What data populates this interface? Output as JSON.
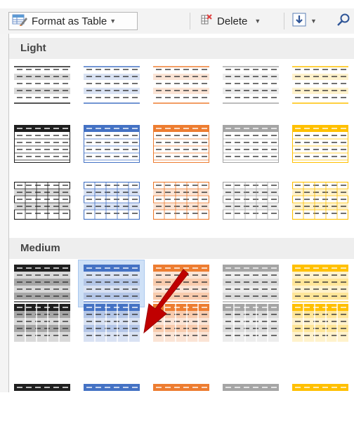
{
  "ribbon": {
    "format_as_table_label": "Format as Table",
    "delete_label": "Delete"
  },
  "gallery": {
    "sections": [
      {
        "title": "Light"
      },
      {
        "title": "Medium"
      }
    ]
  },
  "colors": {
    "black": "#1f1f1f",
    "blue": "#4472c4",
    "orange": "#ed7d31",
    "gray": "#a5a5a5",
    "gold": "#ffc000",
    "arrow_red": "#c00000",
    "selected_bg": "#cfe1f7"
  },
  "icons": [
    "format-as-table-icon",
    "delete-icon",
    "fill-down-icon",
    "search-icon",
    "dropdown-caret-icon",
    "red-arrow-icon"
  ]
}
